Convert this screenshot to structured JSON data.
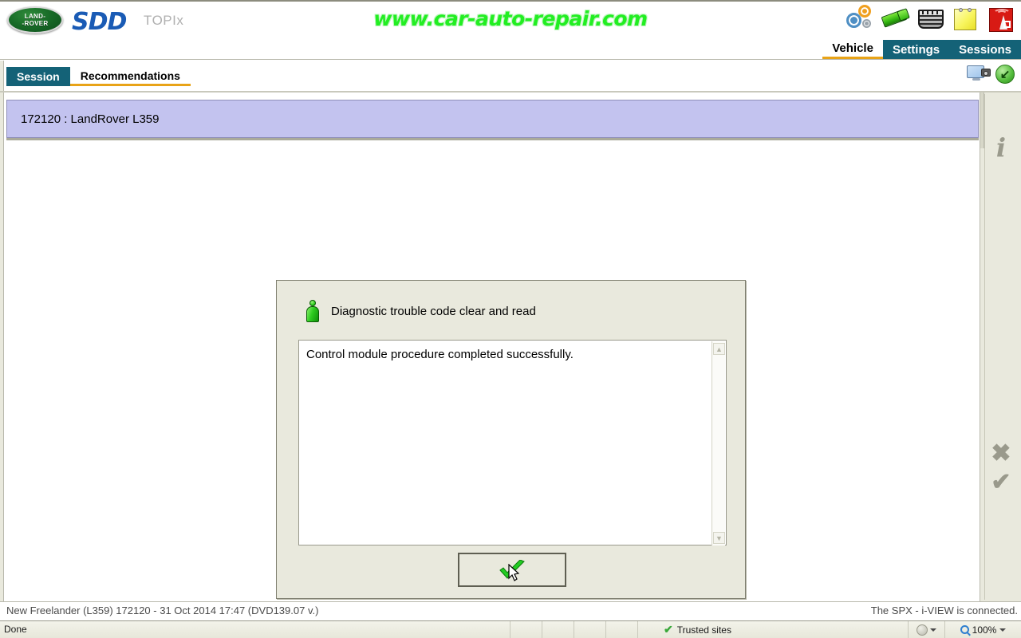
{
  "header": {
    "logo_line1": "LAND-",
    "logo_line2": "-ROVER",
    "product": "SDD",
    "portal": "TOPIx",
    "watermark": "www.car-auto-repair.com",
    "icons": [
      {
        "name": "gears-icon"
      },
      {
        "name": "key-icon"
      },
      {
        "name": "grille-icon"
      },
      {
        "name": "notes-icon"
      },
      {
        "name": "signal-icon"
      }
    ],
    "nav_tabs": [
      {
        "label": "Vehicle",
        "active": true
      },
      {
        "label": "Settings",
        "active": false
      },
      {
        "label": "Sessions",
        "active": false
      }
    ]
  },
  "subbar": {
    "tabs": [
      {
        "label": "Session",
        "active": true
      },
      {
        "label": "Recommendations",
        "active": false
      }
    ],
    "icons": [
      {
        "name": "screenshot-icon"
      },
      {
        "name": "back-icon"
      }
    ]
  },
  "content": {
    "session_band": "172120 : LandRover L359",
    "rail": [
      {
        "name": "info-icon",
        "glyph": "i"
      },
      {
        "name": "cancel-icon",
        "glyph": "✖"
      },
      {
        "name": "confirm-icon",
        "glyph": "✔"
      }
    ]
  },
  "dialog": {
    "title": "Diagnostic trouble code clear and read",
    "message": "Control module procedure completed successfully.",
    "ok_label": "",
    "scroll_up": "▲",
    "scroll_down": "▼"
  },
  "app_status": {
    "left": "New Freelander (L359) 172120 - 31 Oct 2014 17:47 (DVD139.07 v.)",
    "right": "The SPX - i-VIEW is connected."
  },
  "browser_status": {
    "done": "Done",
    "trusted": "Trusted sites",
    "zoom": "100%"
  },
  "colors": {
    "nav_teal": "#146277",
    "accent_gold": "#e8a317",
    "session_band": "#c3c3ef",
    "dialog_bg": "#e9e9dd",
    "watermark_green": "#22ee22"
  }
}
